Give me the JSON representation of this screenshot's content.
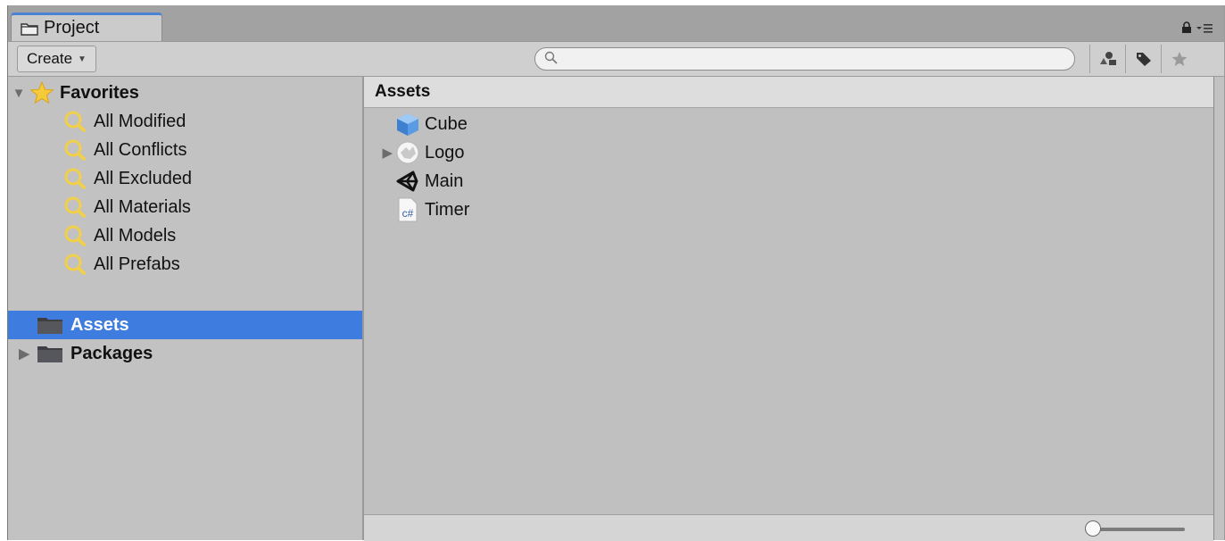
{
  "window": {
    "tab_label": "Project",
    "tab_icon": "folder-icon",
    "menu_icons": [
      "lock-icon",
      "menu-icon"
    ]
  },
  "toolbar": {
    "create_label": "Create",
    "search_placeholder": "",
    "icons": [
      "filter-by-type-icon",
      "filter-by-label-icon",
      "favorites-star-icon"
    ]
  },
  "favorites": {
    "label": "Favorites",
    "items": [
      {
        "label": "All Modified"
      },
      {
        "label": "All Conflicts"
      },
      {
        "label": "All Excluded"
      },
      {
        "label": "All Materials"
      },
      {
        "label": "All Models"
      },
      {
        "label": "All Prefabs"
      }
    ]
  },
  "folders": [
    {
      "label": "Assets",
      "selected": true
    },
    {
      "label": "Packages",
      "selected": false
    }
  ],
  "main": {
    "breadcrumb": "Assets",
    "assets": [
      {
        "label": "Cube",
        "icon": "cube-icon"
      },
      {
        "label": "Logo",
        "icon": "texture-icon"
      },
      {
        "label": "Main",
        "icon": "unity-scene-icon"
      },
      {
        "label": "Timer",
        "icon": "csharp-script-icon",
        "icon_text": "c#"
      }
    ],
    "zoom_level": 0.0
  },
  "colors": {
    "selection": "#3e7ce0",
    "tab_accent": "#4a83d4",
    "magnifier": "#f1cf4a",
    "cube": "#4a8fd8"
  }
}
